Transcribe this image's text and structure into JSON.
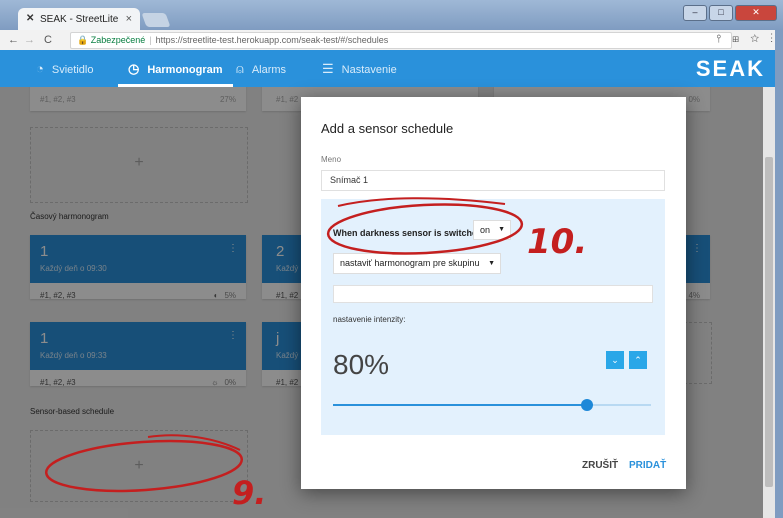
{
  "browser": {
    "tab_title": "SEAK - StreetLite",
    "tab_close": "×",
    "secure_label": "Zabezpečené",
    "url": "https://streetlite-test.herokuapp.com/seak-test/#/schedules",
    "nav_back": "←",
    "nav_forward": "→",
    "nav_reload": "C",
    "toolbar_icons": "⫯ ⊞ ☆ ⋮"
  },
  "appbar": {
    "items": [
      {
        "label": "Svietidlo",
        "icon": "bulb-icon",
        "active": false
      },
      {
        "label": "Harmonogram",
        "icon": "clock-icon",
        "active": true
      },
      {
        "label": "Alarms",
        "icon": "bell-icon",
        "active": false
      },
      {
        "label": "Nastavenie",
        "icon": "sliders-icon",
        "active": false
      }
    ],
    "brand": "SEAK"
  },
  "background": {
    "top_row": [
      {
        "groups": "#1, #2, #3",
        "pct": "27%"
      },
      {
        "groups": "#1, #2"
      },
      {
        "pct": "0%"
      }
    ],
    "section_time": "Časový harmonogram",
    "section_sensor": "Sensor-based schedule",
    "time_cards": [
      {
        "num": "1",
        "sub": "Každý deň o 09:30",
        "groups": "#1, #2, #3",
        "pct": "5%",
        "more": "⋮"
      },
      {
        "num": "2",
        "sub": "Každý",
        "groups": "#1, #2",
        "more": "⋮"
      },
      {
        "num": "1",
        "sub": "Každý deň o 09:33",
        "groups": "#1, #2, #3",
        "pct": "0%",
        "more": "⋮"
      },
      {
        "num": "j",
        "sub": "Každý",
        "groups": "#1, #2",
        "more": "⋮"
      }
    ],
    "right_pct": "4%",
    "plus": "+"
  },
  "dialog": {
    "title": "Add a sensor schedule",
    "name_label": "Meno",
    "name_value": "Snímač 1",
    "condition_label": "When darkness sensor is switched",
    "condition_value": "on",
    "action_value": "nastaviť harmonogram pre skupinu",
    "intensity_label": "nastavenie intenzity:",
    "intensity_value": "80%",
    "intensity_fraction": 0.8,
    "cancel": "ZRUŠIŤ",
    "add": "PRIDAŤ"
  },
  "annotations": {
    "label_10": "10.",
    "label_9": "9."
  },
  "colors": {
    "brand_blue": "#2a91db",
    "annotation_red": "#c41f1f"
  }
}
